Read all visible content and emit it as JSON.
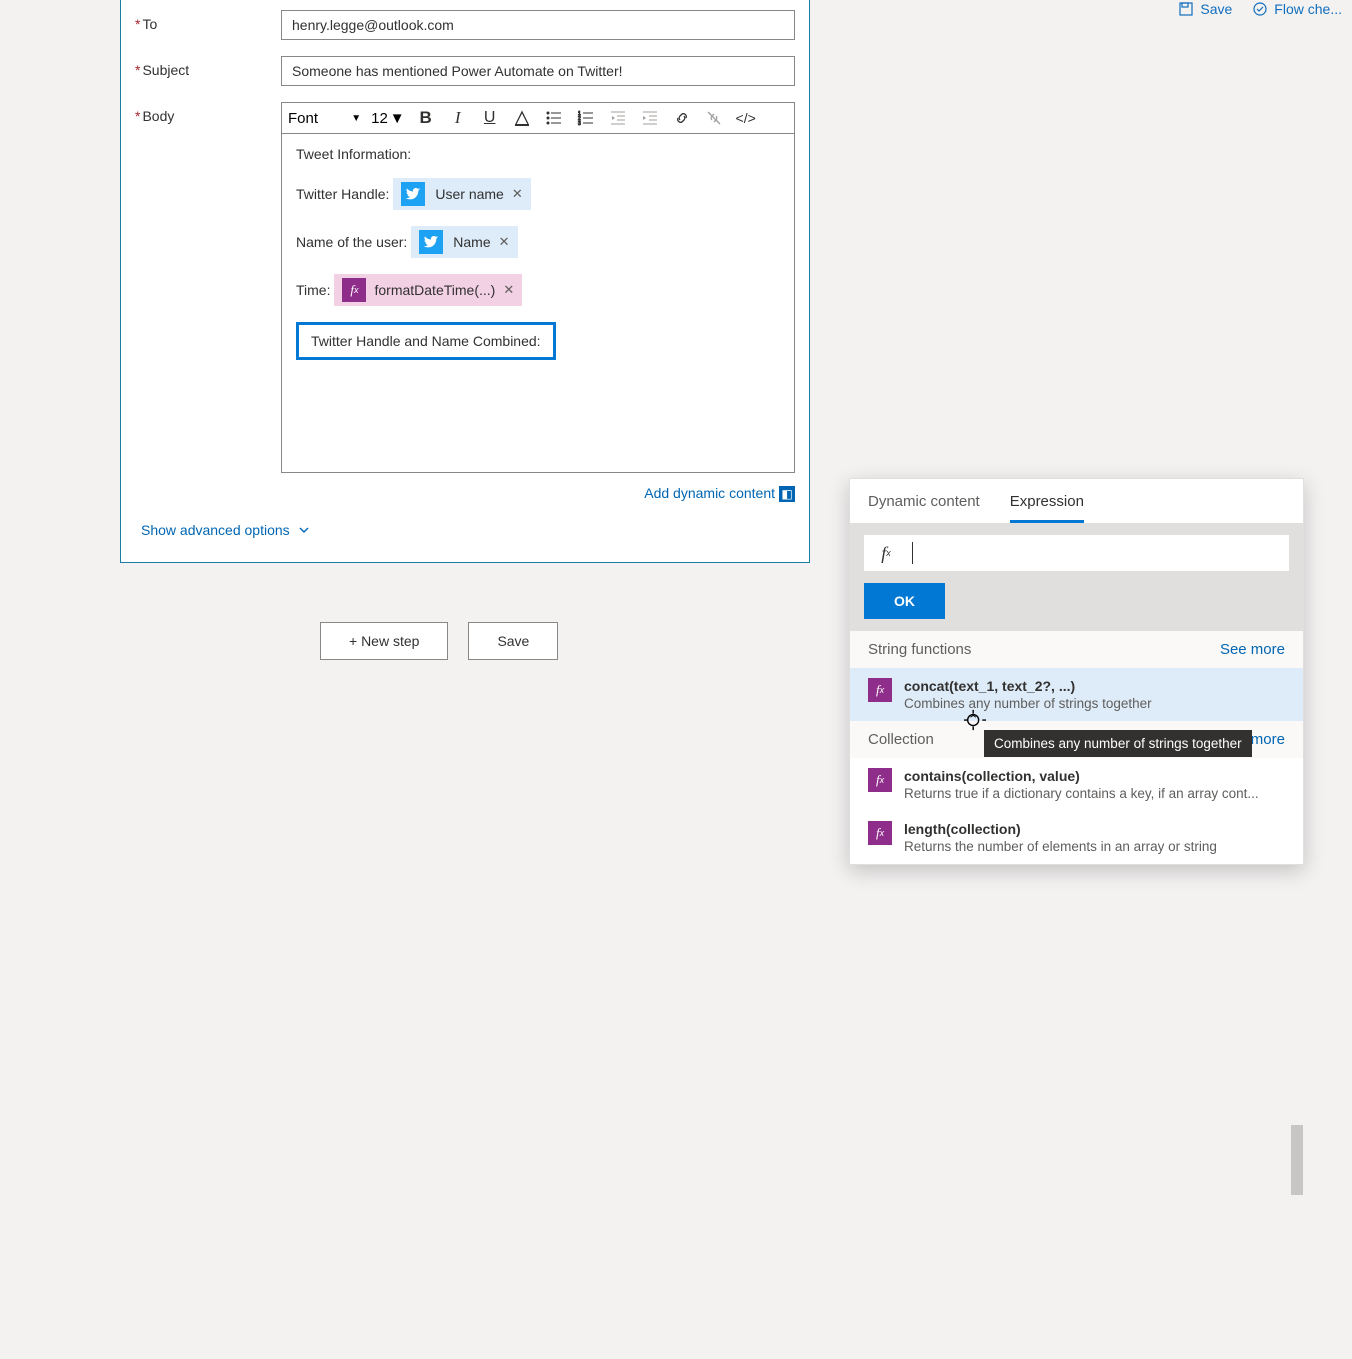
{
  "topbar": {
    "save": "Save",
    "flowcheck": "Flow che..."
  },
  "form": {
    "to_label": "To",
    "to_value": "henry.legge@outlook.com",
    "subject_label": "Subject",
    "subject_value": "Someone has mentioned Power Automate on Twitter!",
    "body_label": "Body",
    "font_label": "Font",
    "font_size": "12",
    "body": {
      "line1": "Tweet Information:",
      "handle_prefix": "Twitter Handle:",
      "handle_token": "User name",
      "name_prefix": "Name of the user:",
      "name_token": "Name",
      "time_prefix": "Time:",
      "time_token": "formatDateTime(...)",
      "combined": "Twitter Handle and Name Combined:"
    },
    "add_dynamic": "Add dynamic content",
    "advanced": "Show advanced options"
  },
  "buttons": {
    "new_step": "+ New step",
    "save": "Save"
  },
  "panel": {
    "tab_dynamic": "Dynamic content",
    "tab_expression": "Expression",
    "ok": "OK",
    "string_section": "String functions",
    "collection_section": "Collection",
    "see_more": "See more",
    "funcs": {
      "concat_name": "concat(text_1, text_2?, ...)",
      "concat_desc": "Combines any number of strings together",
      "contains_name": "contains(collection, value)",
      "contains_desc": "Returns true if a dictionary contains a key, if an array cont...",
      "length_name": "length(collection)",
      "length_desc": "Returns the number of elements in an array or string"
    }
  },
  "tooltip": "Combines any number of strings together"
}
